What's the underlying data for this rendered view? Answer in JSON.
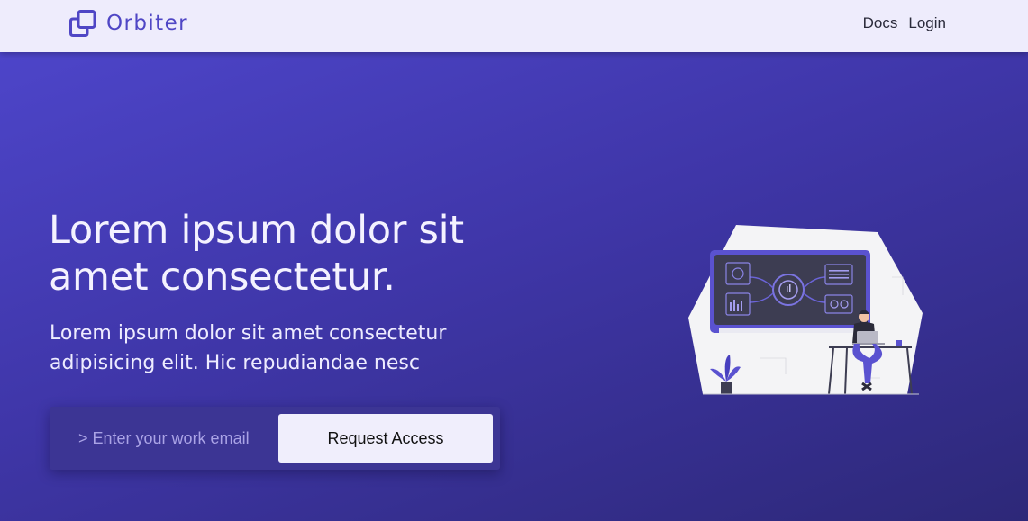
{
  "navbar": {
    "brand_name": "Orbiter",
    "links": [
      {
        "label": "Docs"
      },
      {
        "label": "Login"
      }
    ]
  },
  "hero": {
    "headline": "Lorem ipsum dolor sit amet consectetur.",
    "subtext": "Lorem ipsum dolor sit amet consectetur adipisicing elit. Hic repudiandae nesc",
    "form": {
      "email_placeholder": "> Enter your work email",
      "email_value": "",
      "submit_label": "Request Access"
    },
    "illustration": {
      "icon": "person-at-dashboard-illustration"
    }
  },
  "colors": {
    "brand": "#4f46c5",
    "navbar_bg": "#eeecfc",
    "hero_gradient_start": "#4d45c9",
    "hero_gradient_end": "#2d2878",
    "button_bg": "#f0eefc"
  }
}
